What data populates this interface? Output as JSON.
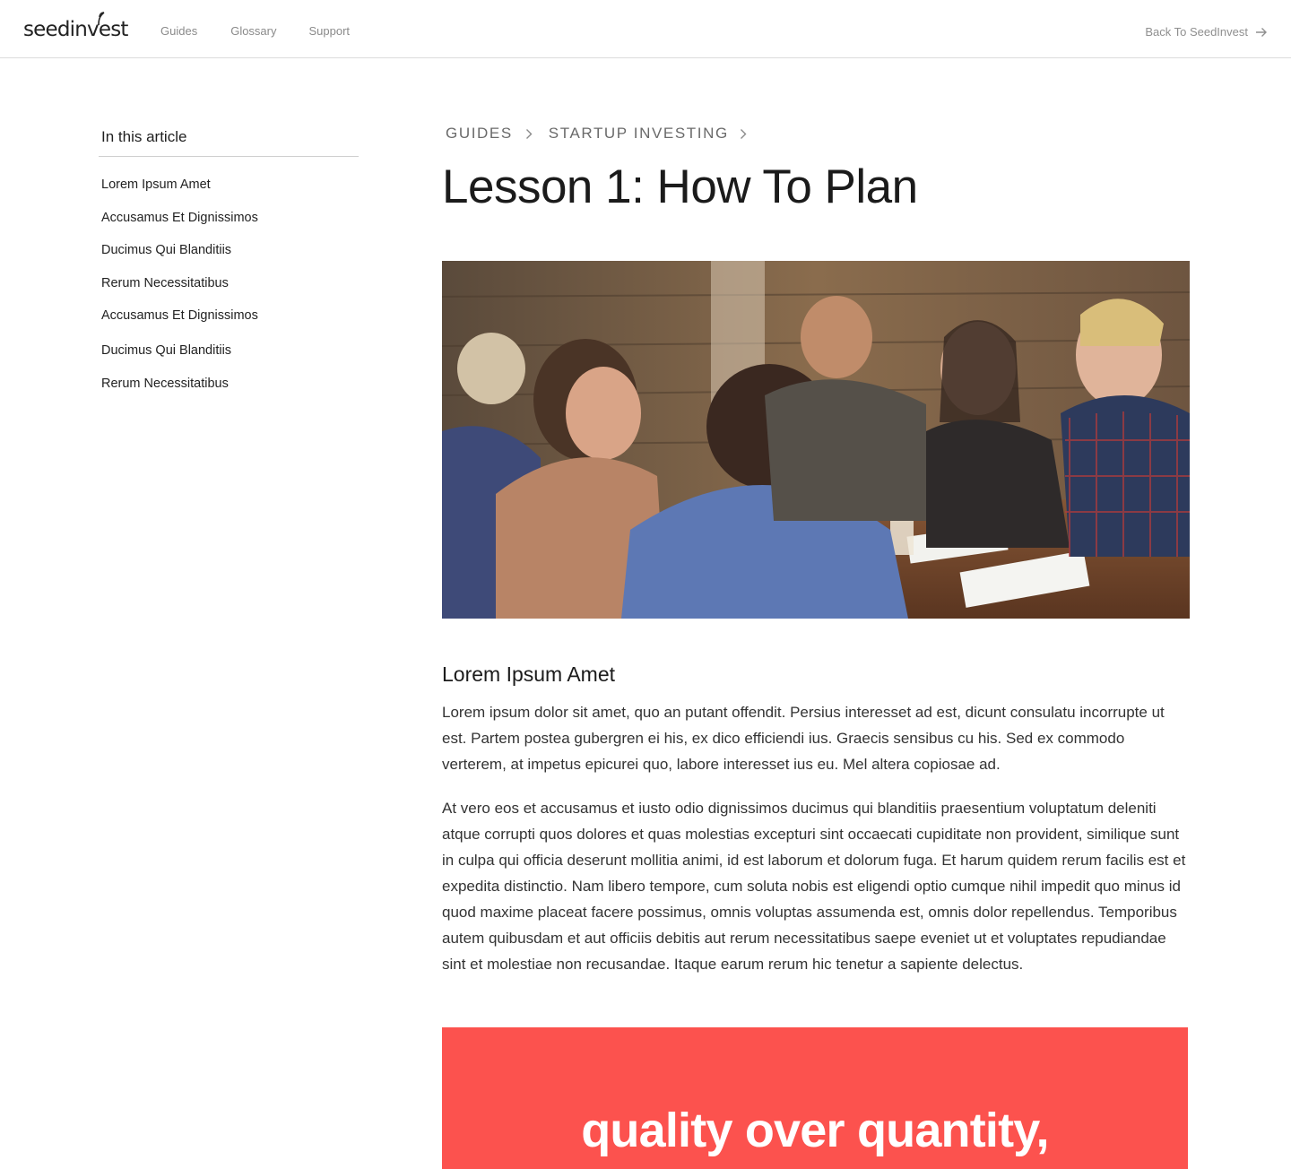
{
  "header": {
    "logo_text": "seedinvest",
    "nav": [
      "Guides",
      "Glossary",
      "Support"
    ],
    "back_link": "Back To SeedInvest"
  },
  "sidebar": {
    "title": "In this article",
    "items": [
      "Lorem Ipsum Amet",
      "Accusamus Et Dignissimos",
      "Ducimus Qui Blanditiis",
      "Rerum Necessitatibus",
      "Accusamus Et Dignissimos",
      "Ducimus Qui Blanditiis",
      "Rerum Necessitatibus"
    ]
  },
  "main": {
    "breadcrumb": [
      "GUIDES",
      "STARTUP INVESTING"
    ],
    "title": "Lesson 1: How To Plan",
    "section_heading": "Lorem Ipsum Amet",
    "paragraphs": [
      "Lorem ipsum dolor sit amet, quo an putant offendit. Persius interesset ad est, dicunt consulatu incorrupte ut est. Partem postea gubergren ei his, ex dico efficiendi ius. Graecis sensibus cu his. Sed ex commodo verterem, at impetus epicurei quo, labore interesset ius eu. Mel altera copiosae ad.",
      "At vero eos et accusamus et iusto odio dignissimos ducimus qui blanditiis praesentium voluptatum deleniti atque corrupti quos dolores et quas molestias excepturi sint occaecati cupiditate non provident, similique sunt in culpa qui officia deserunt mollitia animi, id est laborum et dolorum fuga. Et harum quidem rerum facilis est et expedita distinctio. Nam libero tempore, cum soluta nobis est eligendi optio cumque nihil impedit quo minus id quod maxime placeat facere possimus, omnis voluptas assumenda est, omnis dolor repellendus. Temporibus autem quibusdam et aut officiis debitis aut rerum necessitatibus saepe eveniet ut et voluptates repudiandae sint et molestiae non recusandae. Itaque earum rerum hic tenetur a sapiente delectus."
    ],
    "promo_text": "quality over quantity,"
  },
  "colors": {
    "promo_background": "#fc524e",
    "nav_text": "#8a8a8a",
    "body_text": "#333333"
  },
  "icons": [
    "arrow-right-icon",
    "chevron-right-icon",
    "sprout-icon"
  ]
}
